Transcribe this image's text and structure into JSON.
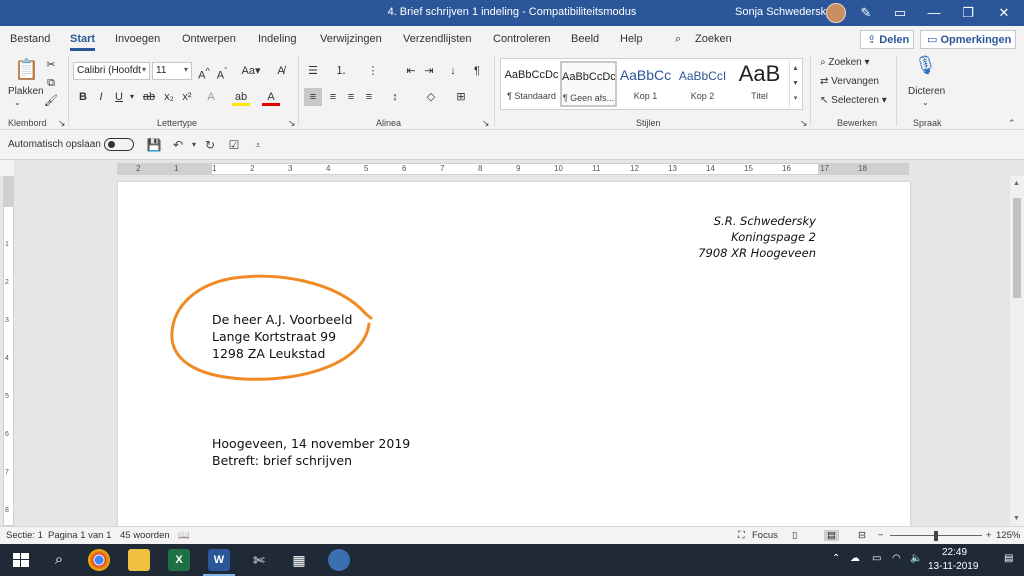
{
  "window": {
    "title": "4. Brief schrijven 1 indeling  -  Compatibiliteitsmodus",
    "user": "Sonja Schwedersky"
  },
  "tabs": [
    "Bestand",
    "Start",
    "Invoegen",
    "Ontwerpen",
    "Indeling",
    "Verwijzingen",
    "Verzendlijsten",
    "Controleren",
    "Beeld",
    "Help"
  ],
  "active_tab": "Start",
  "search_label": "Zoeken",
  "share_label": "Delen",
  "comments_label": "Opmerkingen",
  "ribbon": {
    "clipboard": {
      "paste_label": "Plakken",
      "group_label": "Klembord"
    },
    "font": {
      "name": "Calibri (Hoofdt",
      "size": "11",
      "group_label": "Lettertype",
      "aa_label": "Aa"
    },
    "paragraph": {
      "group_label": "Alinea"
    },
    "styles": {
      "group_label": "Stijlen",
      "items": [
        {
          "sample": "AaBbCcDc",
          "name": "¶ Standaard"
        },
        {
          "sample": "AaBbCcDc",
          "name": "¶ Geen afs..."
        },
        {
          "sample": "AaBbCc",
          "name": "Kop 1"
        },
        {
          "sample": "AaBbCcI",
          "name": "Kop 2"
        },
        {
          "sample": "AaB",
          "name": "Titel"
        }
      ]
    },
    "editing": {
      "find": "Zoeken",
      "replace": "Vervangen",
      "select": "Selecteren",
      "group_label": "Bewerken"
    },
    "voice": {
      "dictate": "Dicteren",
      "group_label": "Spraak"
    }
  },
  "qat": {
    "autosave_label": "Automatisch opslaan"
  },
  "ruler": [
    "2",
    "1",
    "1",
    "2",
    "3",
    "4",
    "5",
    "6",
    "7",
    "8",
    "9",
    "10",
    "11",
    "12",
    "13",
    "14",
    "15",
    "16",
    "17",
    "18"
  ],
  "vruler": [
    "1",
    "2",
    "3",
    "4",
    "5",
    "6",
    "7",
    "8"
  ],
  "document": {
    "sender": [
      "S.R. Schwedersky",
      "Koningspage 2",
      "7908 XR Hoogeveen"
    ],
    "recipient": [
      "De heer A.J. Voorbeeld",
      "Lange Kortstraat 99",
      "1298 ZA Leukstad"
    ],
    "place_date": "Hoogeveen, 14 november 2019",
    "subject": "Betreft: brief schrijven"
  },
  "status": {
    "section": "Sectie: 1",
    "page": "Pagina 1 van 1",
    "words": "45 woorden",
    "focus": "Focus",
    "zoom": "125%"
  },
  "taskbar": {
    "time": "22:49",
    "date": "13-11-2019"
  },
  "colors": {
    "brand": "#2b579a",
    "annotation": "#f08a24"
  }
}
